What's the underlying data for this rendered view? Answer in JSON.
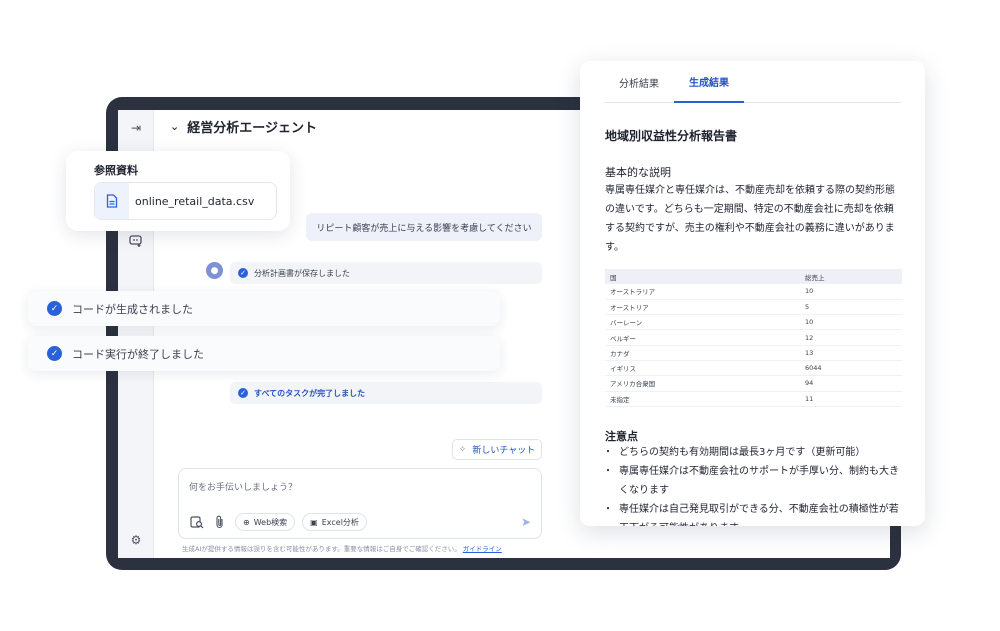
{
  "app": {
    "title": "経営分析エージェント"
  },
  "sidebar": {
    "icons": [
      "collapse-sidebar-icon",
      "chat-history-icon",
      "new-chat-icon",
      "settings-icon"
    ]
  },
  "reference": {
    "title": "参照資料",
    "file_name": "online_retail_data.csv"
  },
  "chat": {
    "user_message": "リピート顧客が売上に与える影響を考慮してください",
    "status_saved": "分析計画書が保存しました",
    "status_code_generated": "コードが生成されました",
    "status_code_executed": "コード実行が終了しました",
    "status_all_done": "すべてのタスクが完了しました",
    "new_chat_label": "新しいチャット"
  },
  "composer": {
    "placeholder": "何をお手伝いしましょう？",
    "web_search_label": "Web検索",
    "excel_label": "Excel分析",
    "disclaimer": "生成AIが提供する情報は誤りを含む可能性があります。重要な情報はご自身でご確認ください。",
    "guideline_link": "ガイドライン"
  },
  "panel": {
    "tabs": [
      {
        "label": "分析結果",
        "active": false
      },
      {
        "label": "生成結果",
        "active": true
      }
    ],
    "report_title": "地域別収益性分析報告書",
    "section_heading": "基本的な説明",
    "body": "専属専任媒介と専任媒介は、不動産売却を依頼する際の契約形態の違いです。どちらも一定期間、特定の不動産会社に売却を依頼する契約ですが、売主の権利や不動産会社の義務に違いがあります。",
    "table": {
      "headers": [
        "国",
        "総売上"
      ],
      "rows": [
        [
          "オーストラリア",
          "10"
        ],
        [
          "オーストリア",
          "5"
        ],
        [
          "バーレーン",
          "10"
        ],
        [
          "ベルギー",
          "12"
        ],
        [
          "カナダ",
          "13"
        ],
        [
          "イギリス",
          "6044"
        ],
        [
          "アメリカ合衆国",
          "94"
        ],
        [
          "未指定",
          "11"
        ]
      ]
    },
    "notes_heading": "注意点",
    "notes": [
      "どちらの契約も有効期間は最長3ヶ月です（更新可能）",
      "専属専任媒介は不動産会社のサポートが手厚い分、制約も大きくなります",
      "専任媒介は自己発見取引ができる分、不動産会社の積極性が若干下がる可能性があります"
    ]
  },
  "colors": {
    "accent": "#2962d8",
    "frame": "#2b313e",
    "user_bubble": "#eef0fa"
  }
}
